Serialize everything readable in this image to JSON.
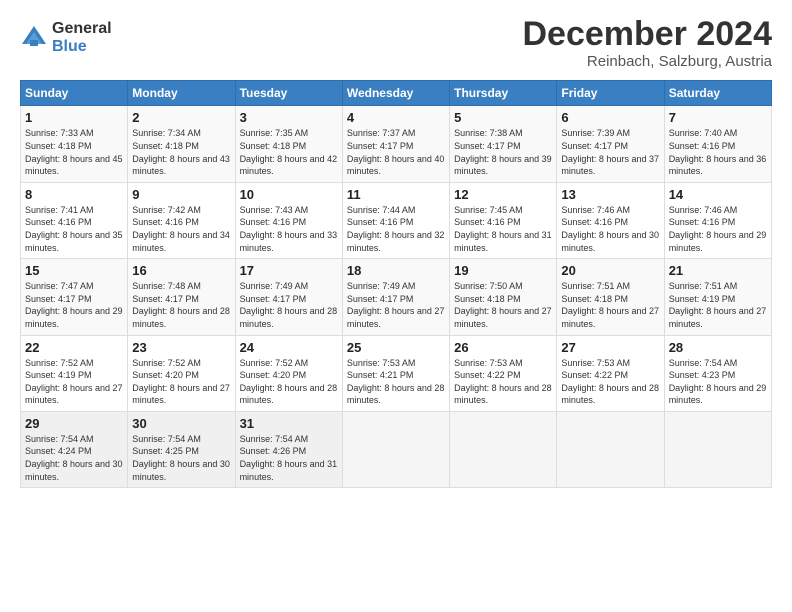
{
  "logo": {
    "general": "General",
    "blue": "Blue"
  },
  "header": {
    "title": "December 2024",
    "subtitle": "Reinbach, Salzburg, Austria"
  },
  "weekdays": [
    "Sunday",
    "Monday",
    "Tuesday",
    "Wednesday",
    "Thursday",
    "Friday",
    "Saturday"
  ],
  "weeks": [
    [
      {
        "day": "1",
        "sunrise": "Sunrise: 7:33 AM",
        "sunset": "Sunset: 4:18 PM",
        "daylight": "Daylight: 8 hours and 45 minutes."
      },
      {
        "day": "2",
        "sunrise": "Sunrise: 7:34 AM",
        "sunset": "Sunset: 4:18 PM",
        "daylight": "Daylight: 8 hours and 43 minutes."
      },
      {
        "day": "3",
        "sunrise": "Sunrise: 7:35 AM",
        "sunset": "Sunset: 4:18 PM",
        "daylight": "Daylight: 8 hours and 42 minutes."
      },
      {
        "day": "4",
        "sunrise": "Sunrise: 7:37 AM",
        "sunset": "Sunset: 4:17 PM",
        "daylight": "Daylight: 8 hours and 40 minutes."
      },
      {
        "day": "5",
        "sunrise": "Sunrise: 7:38 AM",
        "sunset": "Sunset: 4:17 PM",
        "daylight": "Daylight: 8 hours and 39 minutes."
      },
      {
        "day": "6",
        "sunrise": "Sunrise: 7:39 AM",
        "sunset": "Sunset: 4:17 PM",
        "daylight": "Daylight: 8 hours and 37 minutes."
      },
      {
        "day": "7",
        "sunrise": "Sunrise: 7:40 AM",
        "sunset": "Sunset: 4:16 PM",
        "daylight": "Daylight: 8 hours and 36 minutes."
      }
    ],
    [
      {
        "day": "8",
        "sunrise": "Sunrise: 7:41 AM",
        "sunset": "Sunset: 4:16 PM",
        "daylight": "Daylight: 8 hours and 35 minutes."
      },
      {
        "day": "9",
        "sunrise": "Sunrise: 7:42 AM",
        "sunset": "Sunset: 4:16 PM",
        "daylight": "Daylight: 8 hours and 34 minutes."
      },
      {
        "day": "10",
        "sunrise": "Sunrise: 7:43 AM",
        "sunset": "Sunset: 4:16 PM",
        "daylight": "Daylight: 8 hours and 33 minutes."
      },
      {
        "day": "11",
        "sunrise": "Sunrise: 7:44 AM",
        "sunset": "Sunset: 4:16 PM",
        "daylight": "Daylight: 8 hours and 32 minutes."
      },
      {
        "day": "12",
        "sunrise": "Sunrise: 7:45 AM",
        "sunset": "Sunset: 4:16 PM",
        "daylight": "Daylight: 8 hours and 31 minutes."
      },
      {
        "day": "13",
        "sunrise": "Sunrise: 7:46 AM",
        "sunset": "Sunset: 4:16 PM",
        "daylight": "Daylight: 8 hours and 30 minutes."
      },
      {
        "day": "14",
        "sunrise": "Sunrise: 7:46 AM",
        "sunset": "Sunset: 4:16 PM",
        "daylight": "Daylight: 8 hours and 29 minutes."
      }
    ],
    [
      {
        "day": "15",
        "sunrise": "Sunrise: 7:47 AM",
        "sunset": "Sunset: 4:17 PM",
        "daylight": "Daylight: 8 hours and 29 minutes."
      },
      {
        "day": "16",
        "sunrise": "Sunrise: 7:48 AM",
        "sunset": "Sunset: 4:17 PM",
        "daylight": "Daylight: 8 hours and 28 minutes."
      },
      {
        "day": "17",
        "sunrise": "Sunrise: 7:49 AM",
        "sunset": "Sunset: 4:17 PM",
        "daylight": "Daylight: 8 hours and 28 minutes."
      },
      {
        "day": "18",
        "sunrise": "Sunrise: 7:49 AM",
        "sunset": "Sunset: 4:17 PM",
        "daylight": "Daylight: 8 hours and 27 minutes."
      },
      {
        "day": "19",
        "sunrise": "Sunrise: 7:50 AM",
        "sunset": "Sunset: 4:18 PM",
        "daylight": "Daylight: 8 hours and 27 minutes."
      },
      {
        "day": "20",
        "sunrise": "Sunrise: 7:51 AM",
        "sunset": "Sunset: 4:18 PM",
        "daylight": "Daylight: 8 hours and 27 minutes."
      },
      {
        "day": "21",
        "sunrise": "Sunrise: 7:51 AM",
        "sunset": "Sunset: 4:19 PM",
        "daylight": "Daylight: 8 hours and 27 minutes."
      }
    ],
    [
      {
        "day": "22",
        "sunrise": "Sunrise: 7:52 AM",
        "sunset": "Sunset: 4:19 PM",
        "daylight": "Daylight: 8 hours and 27 minutes."
      },
      {
        "day": "23",
        "sunrise": "Sunrise: 7:52 AM",
        "sunset": "Sunset: 4:20 PM",
        "daylight": "Daylight: 8 hours and 27 minutes."
      },
      {
        "day": "24",
        "sunrise": "Sunrise: 7:52 AM",
        "sunset": "Sunset: 4:20 PM",
        "daylight": "Daylight: 8 hours and 28 minutes."
      },
      {
        "day": "25",
        "sunrise": "Sunrise: 7:53 AM",
        "sunset": "Sunset: 4:21 PM",
        "daylight": "Daylight: 8 hours and 28 minutes."
      },
      {
        "day": "26",
        "sunrise": "Sunrise: 7:53 AM",
        "sunset": "Sunset: 4:22 PM",
        "daylight": "Daylight: 8 hours and 28 minutes."
      },
      {
        "day": "27",
        "sunrise": "Sunrise: 7:53 AM",
        "sunset": "Sunset: 4:22 PM",
        "daylight": "Daylight: 8 hours and 28 minutes."
      },
      {
        "day": "28",
        "sunrise": "Sunrise: 7:54 AM",
        "sunset": "Sunset: 4:23 PM",
        "daylight": "Daylight: 8 hours and 29 minutes."
      }
    ],
    [
      {
        "day": "29",
        "sunrise": "Sunrise: 7:54 AM",
        "sunset": "Sunset: 4:24 PM",
        "daylight": "Daylight: 8 hours and 30 minutes."
      },
      {
        "day": "30",
        "sunrise": "Sunrise: 7:54 AM",
        "sunset": "Sunset: 4:25 PM",
        "daylight": "Daylight: 8 hours and 30 minutes."
      },
      {
        "day": "31",
        "sunrise": "Sunrise: 7:54 AM",
        "sunset": "Sunset: 4:26 PM",
        "daylight": "Daylight: 8 hours and 31 minutes."
      },
      null,
      null,
      null,
      null
    ]
  ]
}
